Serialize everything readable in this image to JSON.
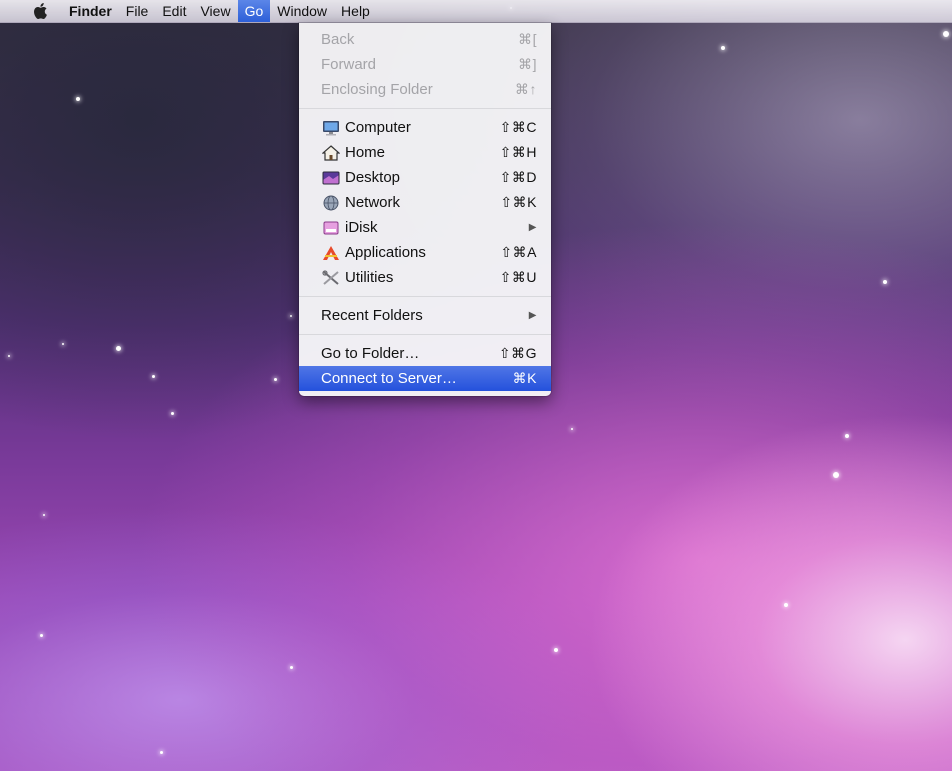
{
  "menubar": {
    "apple_icon": "apple-logo-icon",
    "items": [
      {
        "label": "Finder",
        "bold": true
      },
      {
        "label": "File"
      },
      {
        "label": "Edit"
      },
      {
        "label": "View"
      },
      {
        "label": "Go",
        "active": true
      },
      {
        "label": "Window"
      },
      {
        "label": "Help"
      }
    ]
  },
  "go_menu": {
    "sections": [
      [
        {
          "label": "Back",
          "shortcut": "⌘[",
          "disabled": true
        },
        {
          "label": "Forward",
          "shortcut": "⌘]",
          "disabled": true
        },
        {
          "label": "Enclosing Folder",
          "shortcut": "⌘↑",
          "disabled": true
        }
      ],
      [
        {
          "label": "Computer",
          "shortcut": "⇧⌘C",
          "icon": "computer-icon"
        },
        {
          "label": "Home",
          "shortcut": "⇧⌘H",
          "icon": "home-icon"
        },
        {
          "label": "Desktop",
          "shortcut": "⇧⌘D",
          "icon": "desktop-icon"
        },
        {
          "label": "Network",
          "shortcut": "⇧⌘K",
          "icon": "network-icon"
        },
        {
          "label": "iDisk",
          "shortcut": "▶",
          "icon": "idisk-icon",
          "submenu": true
        },
        {
          "label": "Applications",
          "shortcut": "⇧⌘A",
          "icon": "applications-icon"
        },
        {
          "label": "Utilities",
          "shortcut": "⇧⌘U",
          "icon": "utilities-icon"
        }
      ],
      [
        {
          "label": "Recent Folders",
          "shortcut": "▶",
          "submenu": true
        }
      ],
      [
        {
          "label": "Go to Folder…",
          "shortcut": "⇧⌘G"
        },
        {
          "label": "Connect to Server…",
          "shortcut": "⌘K",
          "highlighted": true
        }
      ]
    ]
  },
  "colors": {
    "menu_highlight": "#2d5fd8",
    "disabled_text": "#a4a4a8"
  }
}
